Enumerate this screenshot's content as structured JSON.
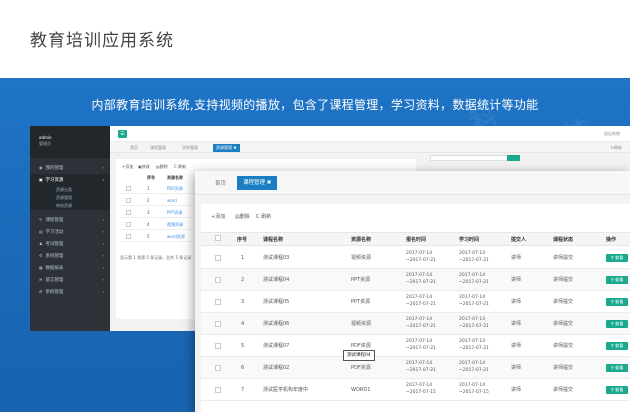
{
  "header": {
    "title": "教育培训应用系统"
  },
  "banner": {
    "text": "内部教育培训系统,支持视频的播放，包含了课程管理，学习资料，数据统计等功能"
  },
  "back_window": {
    "user": {
      "name": "admin",
      "role": "管理员"
    },
    "sidebar": [
      {
        "label": "我的管理",
        "active": false
      },
      {
        "label": "学习资源",
        "active": true
      },
      {
        "label": "课程管理",
        "active": false
      },
      {
        "label": "学习活动",
        "active": false
      },
      {
        "label": "考试管理",
        "active": false
      },
      {
        "label": "系统管理",
        "active": false
      },
      {
        "label": "数据报表",
        "active": false
      },
      {
        "label": "留言管理",
        "active": false
      },
      {
        "label": "系统管理",
        "active": false
      }
    ],
    "sidebar_sub": [
      "资源分类",
      "资源管理",
      "审核资源"
    ],
    "logout": "退出系统",
    "tabs": [
      "首页",
      "课程管理",
      "学校管理",
      "资源管理"
    ],
    "refresh": "刷新",
    "toolbar": [
      "添加",
      "修改",
      "删除",
      "C 刷新"
    ],
    "columns": [
      "序号",
      "资源名称"
    ],
    "rows": [
      {
        "num": "1",
        "name": "PDF资源"
      },
      {
        "num": "2",
        "name": "word"
      },
      {
        "num": "3",
        "name": "PPT资源"
      },
      {
        "num": "4",
        "name": "视频资源"
      },
      {
        "num": "5",
        "name": "word资源"
      }
    ],
    "footer": "显示第 1 到第 5 条记录，总共 5 条记录"
  },
  "front_window": {
    "tab_home": "首页",
    "tab_active": "课程管理",
    "toolbar": {
      "add": "+添加",
      "delete": "删除",
      "refresh": "C 刷新"
    },
    "columns": [
      "序号",
      "课程名称",
      "资源名称",
      "报名时间",
      "学习时间",
      "提交人",
      "课程状态",
      "操作"
    ],
    "rows": [
      {
        "num": "1",
        "name": "测试课程03",
        "source": "视频资源",
        "signup": [
          "2017-07-14",
          "~2017-07-21"
        ],
        "study": [
          "2017-07-14",
          "~2017-07-21"
        ],
        "submitter": "讲师",
        "status": "讲师提交",
        "op": "查看"
      },
      {
        "num": "2",
        "name": "测试课程04",
        "source": "PPT资源",
        "signup": [
          "2017-07-14",
          "~2017-07-21"
        ],
        "study": [
          "2017-07-14",
          "~2017-07-21"
        ],
        "submitter": "讲师",
        "status": "讲师提交",
        "op": "查看"
      },
      {
        "num": "3",
        "name": "测试课程05",
        "source": "PPT资源",
        "signup": [
          "2017-07-14",
          "~2017-07-21"
        ],
        "study": [
          "2017-07-14",
          "~2017-07-21"
        ],
        "submitter": "讲师",
        "status": "讲师提交",
        "op": "查看"
      },
      {
        "num": "4",
        "name": "测试课程06",
        "source": "视频资源",
        "signup": [
          "2017-07-14",
          "~2017-07-21"
        ],
        "study": [
          "2017-07-14",
          "~2017-07-21"
        ],
        "submitter": "讲师",
        "status": "讲师提交",
        "op": "查看"
      },
      {
        "num": "5",
        "name": "测试课程07",
        "source": "PDF资源",
        "signup": [
          "2017-07-14",
          "~2017-07-21"
        ],
        "study": [
          "2017-07-14",
          "~2017-07-21"
        ],
        "submitter": "讲师",
        "status": "讲师提交",
        "op": "查看"
      },
      {
        "num": "6",
        "name": "测试课程02",
        "source": "PDF资源",
        "signup": [
          "2017-07-14",
          "~2017-07-21"
        ],
        "study": [
          "2017-07-14",
          "~2017-07-21"
        ],
        "submitter": "讲师",
        "status": "讲师提交",
        "op": "查看"
      },
      {
        "num": "7",
        "name": "测试医学机构年度中",
        "source": "WORD1",
        "signup": [
          "2017-07-14",
          "~2017-07-15"
        ],
        "study": [
          "2017-07-14",
          "~2017-07-15"
        ],
        "submitter": "讲师",
        "status": "讲师提交",
        "op": "查看"
      }
    ],
    "tooltip": "测试课程04"
  },
  "colors": {
    "header_bg": "#ffffff",
    "banner": "#1a6cbd",
    "sidebar": "#2c3238",
    "accent": "#19aa8d",
    "tab_active": "#1a7ec2"
  }
}
